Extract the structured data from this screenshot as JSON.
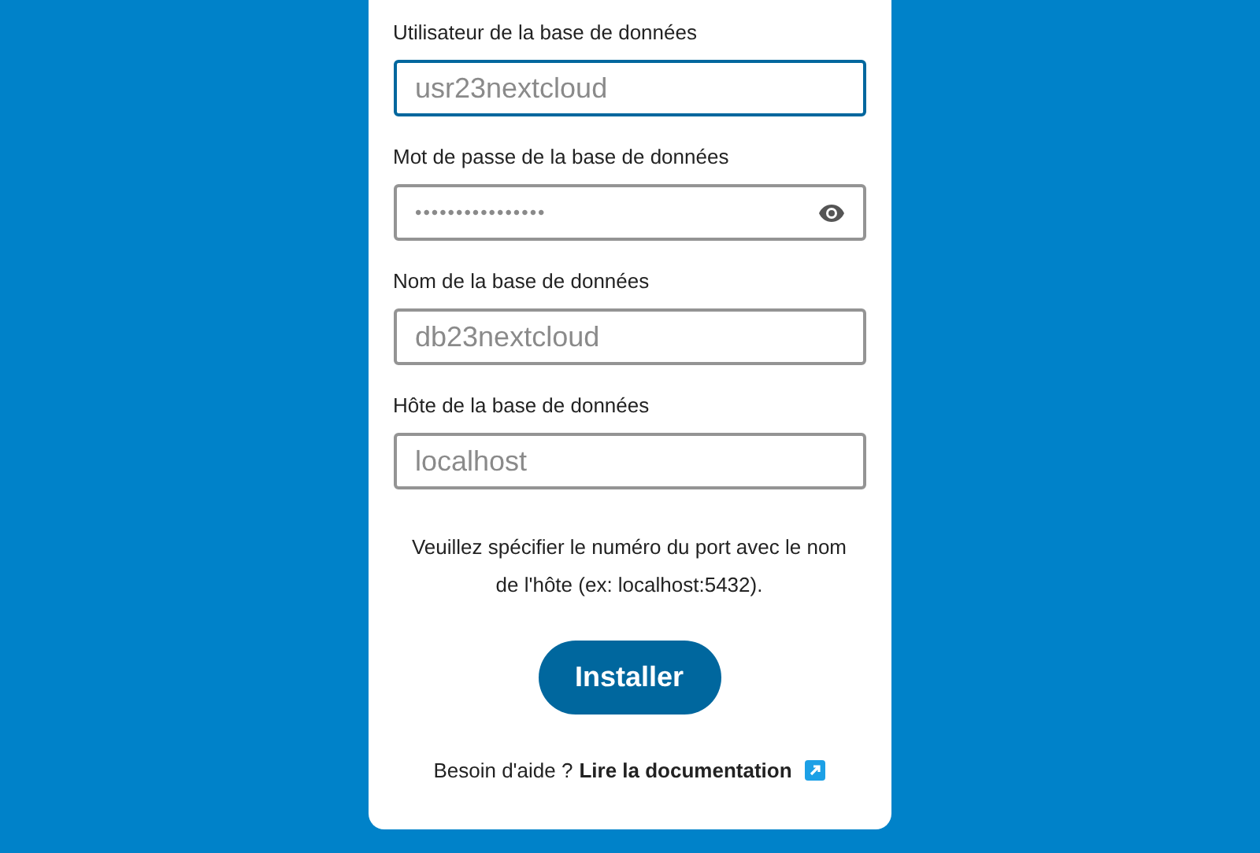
{
  "fields": [
    {
      "label": "Utilisateur de la base de données",
      "value": "usr23nextcloud",
      "focused": true,
      "kind": "text"
    },
    {
      "label": "Mot de passe de la base de données",
      "value": "••••••••••••••••",
      "focused": false,
      "kind": "password"
    },
    {
      "label": "Nom de la base de données",
      "value": "db23nextcloud",
      "focused": false,
      "kind": "text"
    },
    {
      "label": "Hôte de la base de données",
      "value": "localhost",
      "focused": false,
      "kind": "text"
    }
  ],
  "hint": "Veuillez spécifier le numéro du port avec le nom de l'hôte (ex: localhost:5432).",
  "install_button": "Installer",
  "help": {
    "text": "Besoin d'aide ?",
    "link": "Lire la documentation"
  }
}
